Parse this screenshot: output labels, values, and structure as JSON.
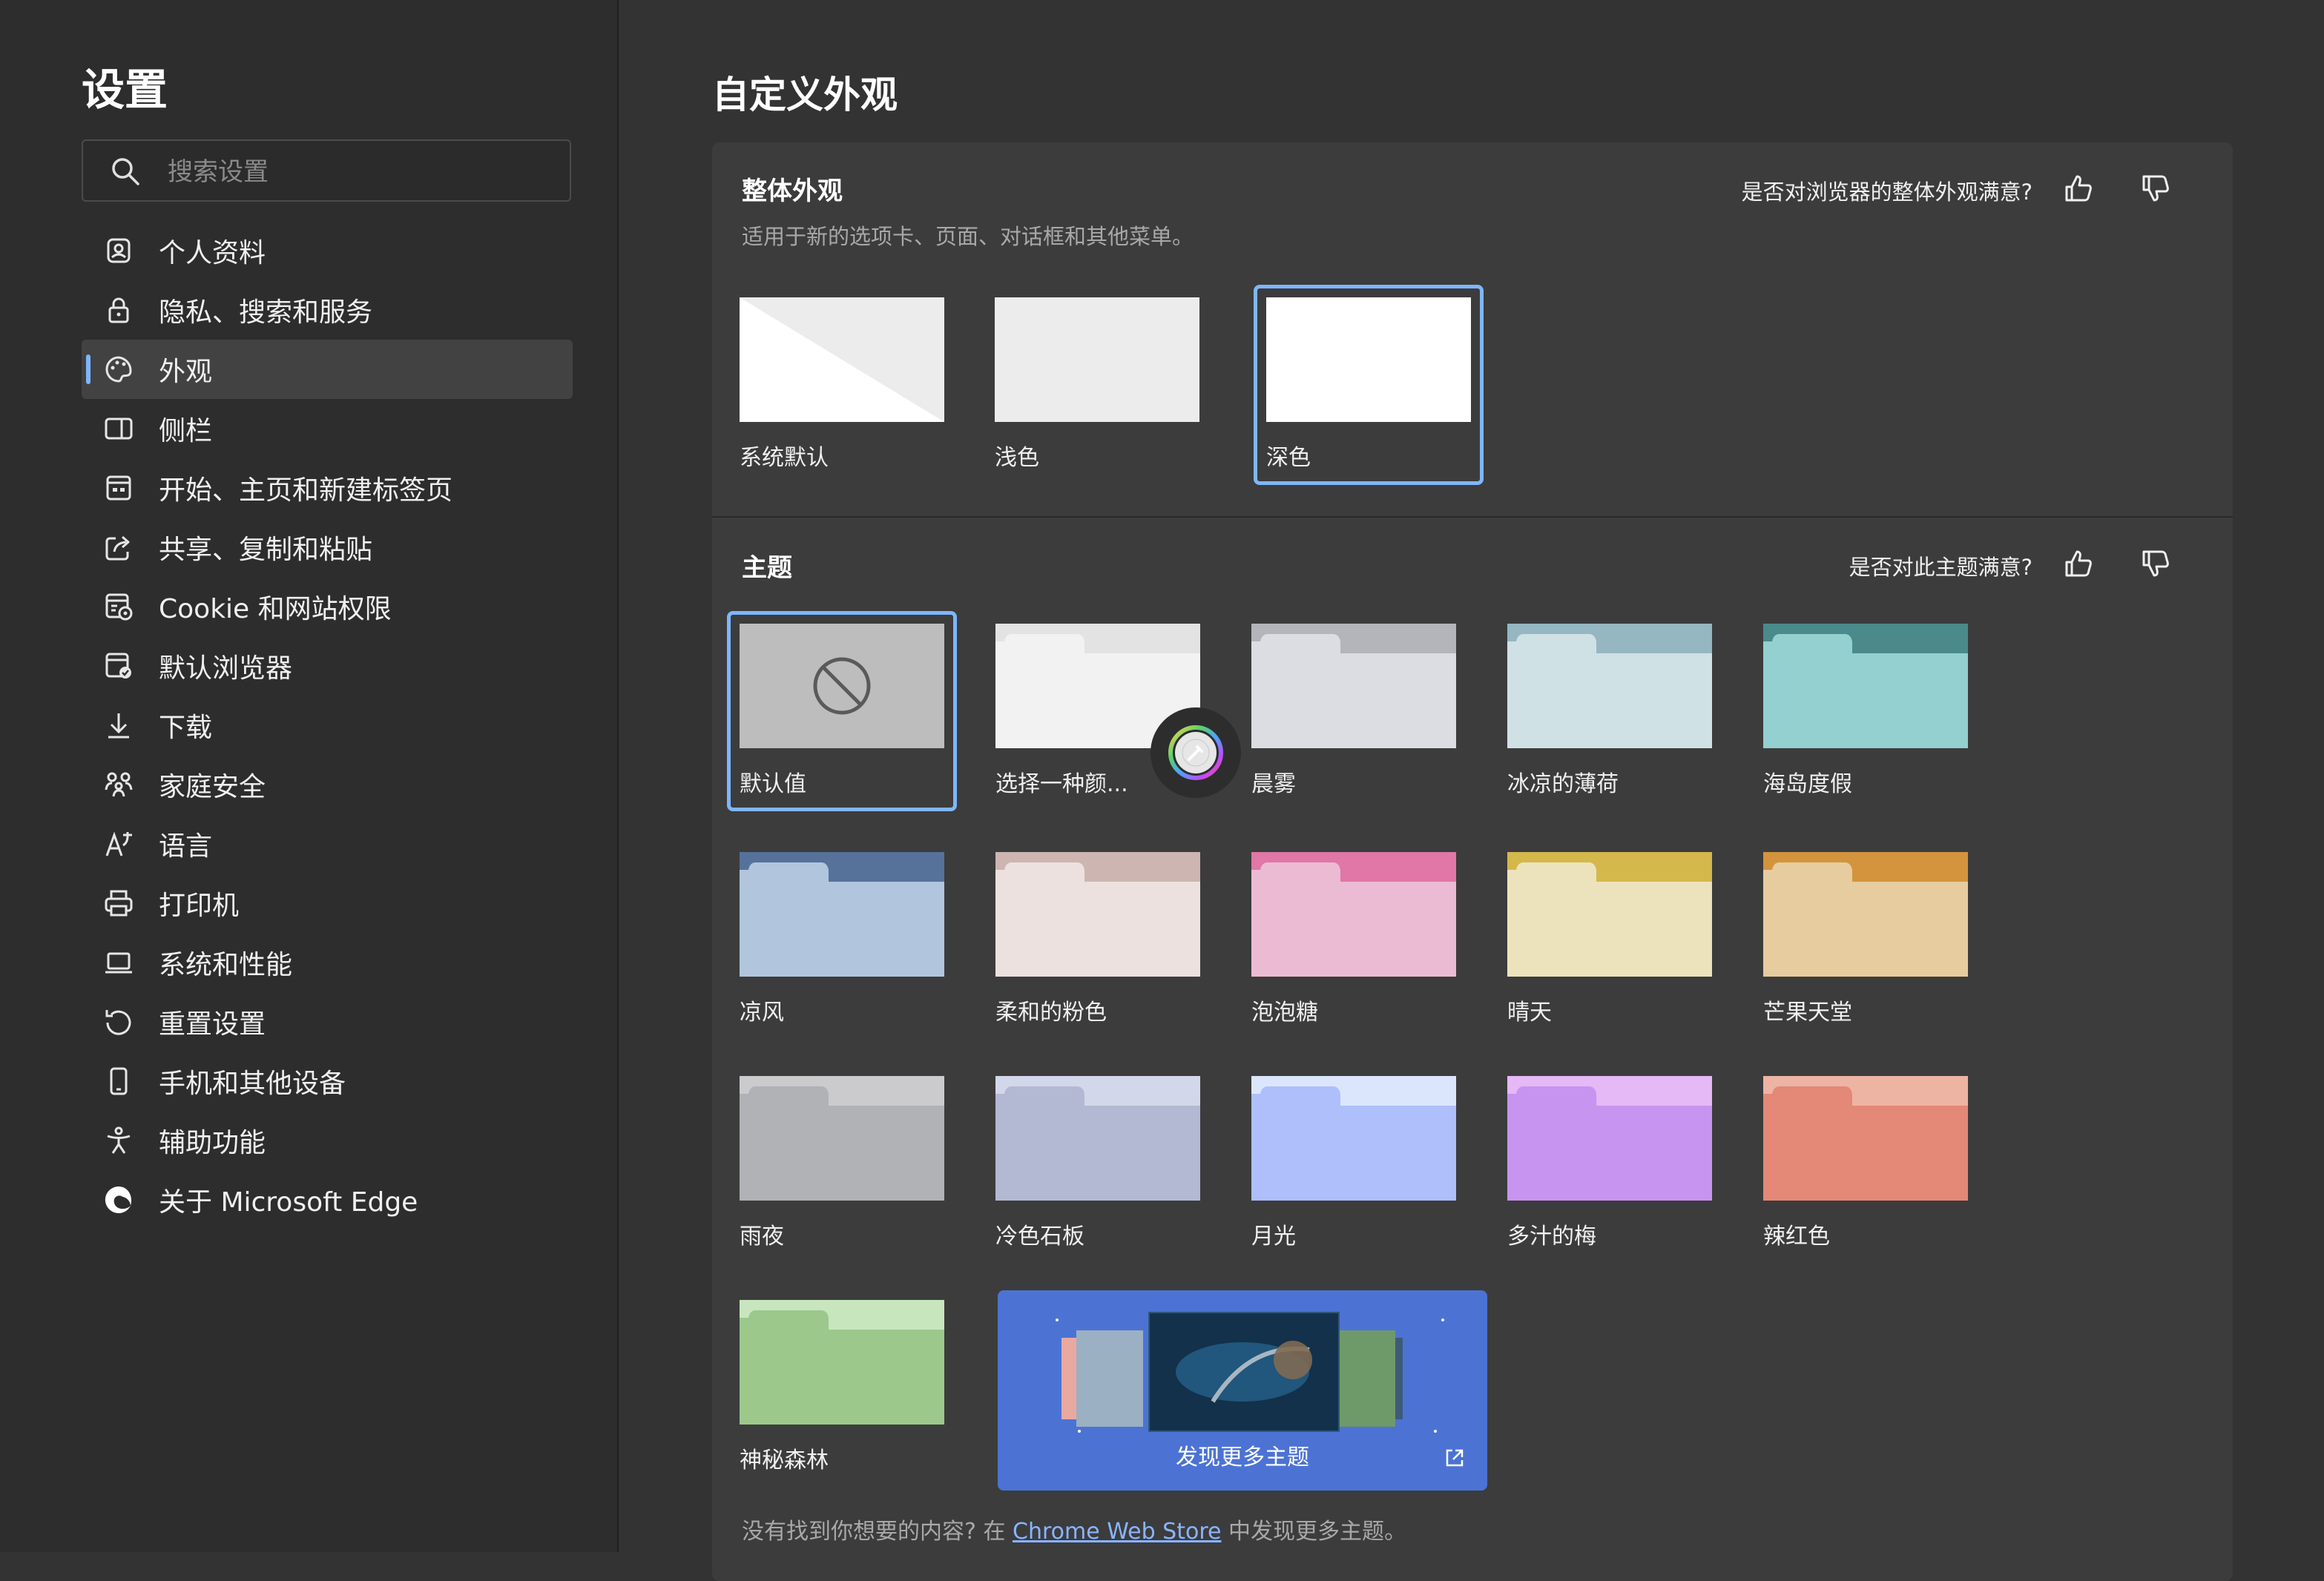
{
  "sidebar": {
    "title": "设置",
    "search_placeholder": "搜索设置",
    "items": [
      {
        "label": "个人资料",
        "icon": "profile-icon"
      },
      {
        "label": "隐私、搜索和服务",
        "icon": "lock-icon"
      },
      {
        "label": "外观",
        "icon": "palette-icon",
        "active": true
      },
      {
        "label": "侧栏",
        "icon": "sidebar-icon"
      },
      {
        "label": "开始、主页和新建标签页",
        "icon": "home-icon"
      },
      {
        "label": "共享、复制和粘贴",
        "icon": "share-icon"
      },
      {
        "label": "Cookie 和网站权限",
        "icon": "cookie-icon"
      },
      {
        "label": "默认浏览器",
        "icon": "browser-icon"
      },
      {
        "label": "下载",
        "icon": "download-icon"
      },
      {
        "label": "家庭安全",
        "icon": "family-icon"
      },
      {
        "label": "语言",
        "icon": "language-icon"
      },
      {
        "label": "打印机",
        "icon": "printer-icon"
      },
      {
        "label": "系统和性能",
        "icon": "laptop-icon"
      },
      {
        "label": "重置设置",
        "icon": "reset-icon"
      },
      {
        "label": "手机和其他设备",
        "icon": "phone-icon"
      },
      {
        "label": "辅助功能",
        "icon": "accessibility-icon"
      },
      {
        "label": "关于 Microsoft Edge",
        "icon": "edge-logo-icon"
      }
    ]
  },
  "main": {
    "title": "自定义外观",
    "overall": {
      "title": "整体外观",
      "description": "适用于新的选项卡、页面、对话框和其他菜单。",
      "feedback_question": "是否对浏览器的整体外观满意?",
      "options": [
        {
          "label": "系统默认"
        },
        {
          "label": "浅色"
        },
        {
          "label": "深色",
          "selected": true
        }
      ]
    },
    "themes": {
      "title": "主题",
      "feedback_question": "是否对此主题满意?",
      "items": [
        {
          "label": "默认值",
          "kind": "default",
          "selected": true
        },
        {
          "label": "选择一种颜...",
          "kind": "custom",
          "tab": "#e3e3e3",
          "body": "#f2f2f2"
        },
        {
          "label": "晨雾",
          "tab": "#b3b5bb",
          "body": "#dcdde2"
        },
        {
          "label": "冰凉的薄荷",
          "tab": "#95b7c1",
          "body": "#d0e1e6"
        },
        {
          "label": "海岛度假",
          "tab": "#4b8a8a",
          "body": "#93d0cf"
        },
        {
          "label": "凉风",
          "tab": "#56729a",
          "body": "#b1c6dd"
        },
        {
          "label": "柔和的粉色",
          "tab": "#cdb5b1",
          "body": "#ece1df"
        },
        {
          "label": "泡泡糖",
          "tab": "#e077a6",
          "body": "#ebbbd3"
        },
        {
          "label": "晴天",
          "tab": "#d4b84b",
          "body": "#ece3bd"
        },
        {
          "label": "芒果天堂",
          "tab": "#d4943d",
          "body": "#e6cc9f"
        },
        {
          "label": "雨夜",
          "tab": "#cbcbce",
          "body": "#b1b2b6"
        },
        {
          "label": "冷色石板",
          "tab": "#d3d7ea",
          "body": "#b3b9d3"
        },
        {
          "label": "月光",
          "tab": "#dbe6fd",
          "body": "#aebffc"
        },
        {
          "label": "多汁的梅",
          "tab": "#e4b9f6",
          "body": "#c794f0"
        },
        {
          "label": "辣红色",
          "tab": "#edb4a4",
          "body": "#e48877"
        },
        {
          "label": "神秘森林",
          "tab": "#c7e6bd",
          "body": "#9cc88c"
        }
      ],
      "store_label": "发现更多主题",
      "footer_prefix": "没有找到你想要的内容? 在",
      "footer_link": "Chrome Web Store",
      "footer_suffix": "中发现更多主题。"
    }
  },
  "colors": {
    "background": "#333333",
    "sidebar": "#2d2d2d",
    "card": "#3c3c3c",
    "accent": "#7eb6ff",
    "store": "#4c73d4"
  }
}
